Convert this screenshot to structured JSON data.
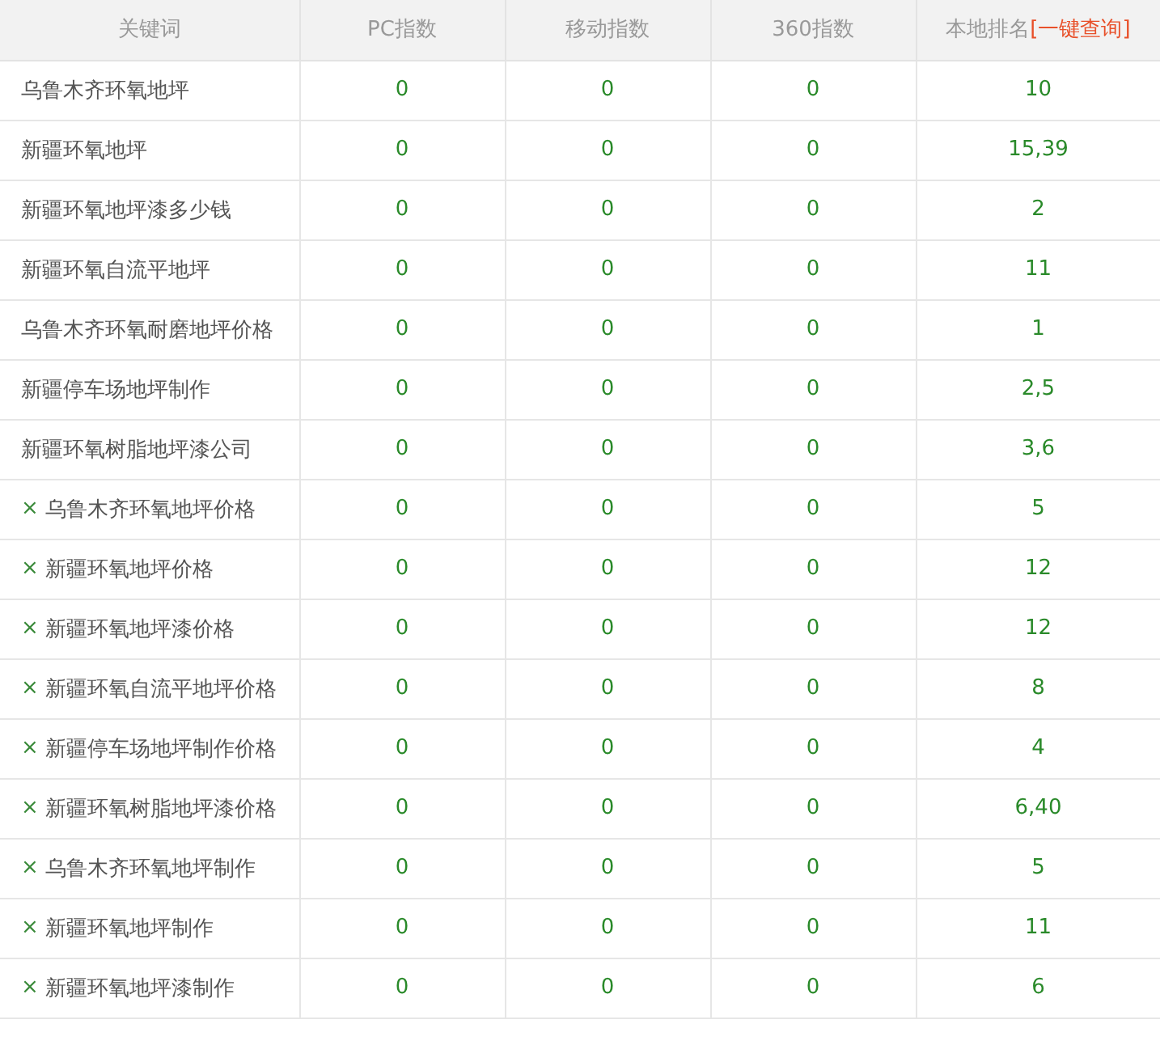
{
  "table": {
    "columns": [
      {
        "label": "关键词"
      },
      {
        "label": "PC指数"
      },
      {
        "label": "移动指数"
      },
      {
        "label": "360指数"
      },
      {
        "label": "本地排名",
        "link": "[一键查询]"
      }
    ],
    "rows": [
      {
        "keyword": "乌鲁木齐环氧地坪",
        "pc": "0",
        "mobile": "0",
        "s360": "0",
        "rank": "10"
      },
      {
        "keyword": "新疆环氧地坪",
        "pc": "0",
        "mobile": "0",
        "s360": "0",
        "rank": "15,39"
      },
      {
        "keyword": "新疆环氧地坪漆多少钱",
        "pc": "0",
        "mobile": "0",
        "s360": "0",
        "rank": "2"
      },
      {
        "keyword": "新疆环氧自流平地坪",
        "pc": "0",
        "mobile": "0",
        "s360": "0",
        "rank": "11"
      },
      {
        "keyword": "乌鲁木齐环氧耐磨地坪价格",
        "pc": "0",
        "mobile": "0",
        "s360": "0",
        "rank": "1"
      },
      {
        "keyword": "新疆停车场地坪制作",
        "pc": "0",
        "mobile": "0",
        "s360": "0",
        "rank": "2,5"
      },
      {
        "keyword": "新疆环氧树脂地坪漆公司",
        "pc": "0",
        "mobile": "0",
        "s360": "0",
        "rank": "3,6"
      },
      {
        "remove": "×",
        "keyword": "乌鲁木齐环氧地坪价格",
        "pc": "0",
        "mobile": "0",
        "s360": "0",
        "rank": "5"
      },
      {
        "remove": "×",
        "keyword": "新疆环氧地坪价格",
        "pc": "0",
        "mobile": "0",
        "s360": "0",
        "rank": "12"
      },
      {
        "remove": "×",
        "keyword": "新疆环氧地坪漆价格",
        "pc": "0",
        "mobile": "0",
        "s360": "0",
        "rank": "12"
      },
      {
        "remove": "×",
        "keyword": "新疆环氧自流平地坪价格",
        "pc": "0",
        "mobile": "0",
        "s360": "0",
        "rank": "8"
      },
      {
        "remove": "×",
        "keyword": "新疆停车场地坪制作价格",
        "pc": "0",
        "mobile": "0",
        "s360": "0",
        "rank": "4"
      },
      {
        "remove": "×",
        "keyword": "新疆环氧树脂地坪漆价格",
        "pc": "0",
        "mobile": "0",
        "s360": "0",
        "rank": "6,40"
      },
      {
        "remove": "×",
        "keyword": "乌鲁木齐环氧地坪制作",
        "pc": "0",
        "mobile": "0",
        "s360": "0",
        "rank": "5"
      },
      {
        "remove": "×",
        "keyword": "新疆环氧地坪制作",
        "pc": "0",
        "mobile": "0",
        "s360": "0",
        "rank": "11"
      },
      {
        "remove": "×",
        "keyword": "新疆环氧地坪漆制作",
        "pc": "0",
        "mobile": "0",
        "s360": "0",
        "rank": "6"
      }
    ]
  }
}
